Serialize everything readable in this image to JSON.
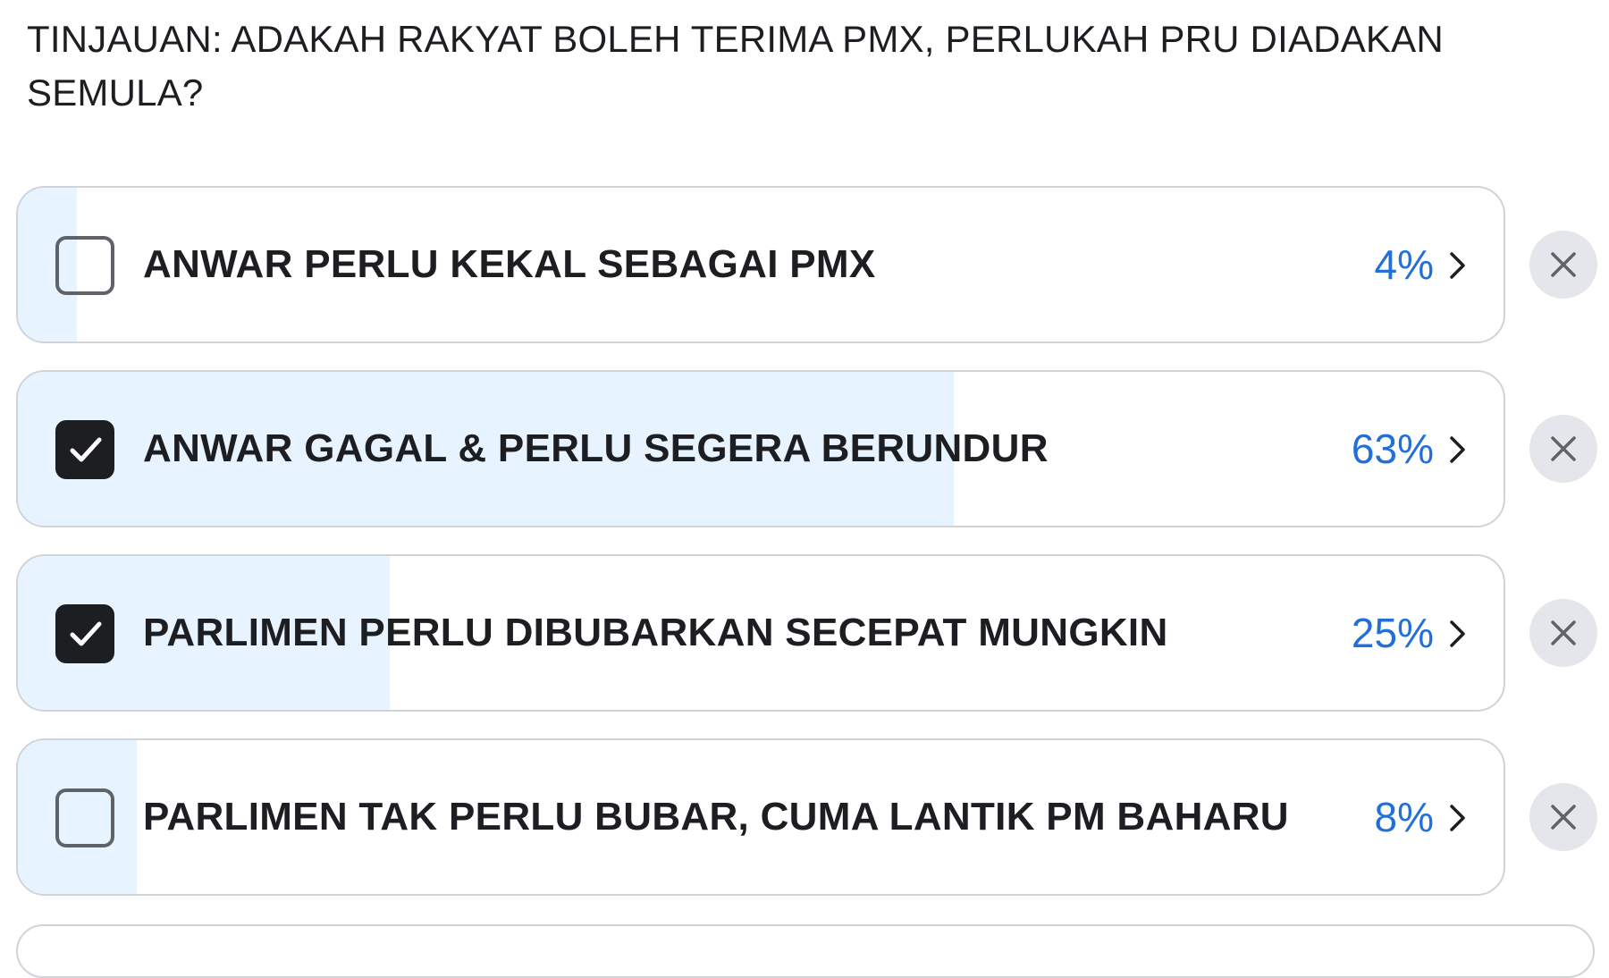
{
  "poll": {
    "question": "TINJAUAN: ADAKAH RAKYAT BOLEH TERIMA PMX, PERLUKAH PRU DIADAKAN SEMULA?",
    "colors": {
      "fill": "#e7f3ff",
      "percent": "#216fdb",
      "checked_box": "#1c1e21",
      "border": "#d0d3d8",
      "remove_bg": "#e4e6eb"
    },
    "options": [
      {
        "label": "ANWAR PERLU KEKAL SEBAGAI PMX",
        "percent_text": "4%",
        "percent": 4,
        "checked": false,
        "icons": [
          "checkbox-icon",
          "chevron-right-icon",
          "close-icon"
        ]
      },
      {
        "label": "ANWAR GAGAL & PERLU SEGERA BERUNDUR",
        "percent_text": "63%",
        "percent": 63,
        "checked": true,
        "icons": [
          "checkbox-checked-icon",
          "chevron-right-icon",
          "close-icon"
        ]
      },
      {
        "label": "PARLIMEN PERLU DIBUBARKAN SECEPAT MUNGKIN",
        "percent_text": "25%",
        "percent": 25,
        "checked": true,
        "icons": [
          "checkbox-checked-icon",
          "chevron-right-icon",
          "close-icon"
        ]
      },
      {
        "label": "PARLIMEN TAK PERLU BUBAR, CUMA LANTIK PM BAHARU",
        "percent_text": "8%",
        "percent": 8,
        "checked": false,
        "icons": [
          "checkbox-icon",
          "chevron-right-icon",
          "close-icon"
        ]
      }
    ]
  }
}
